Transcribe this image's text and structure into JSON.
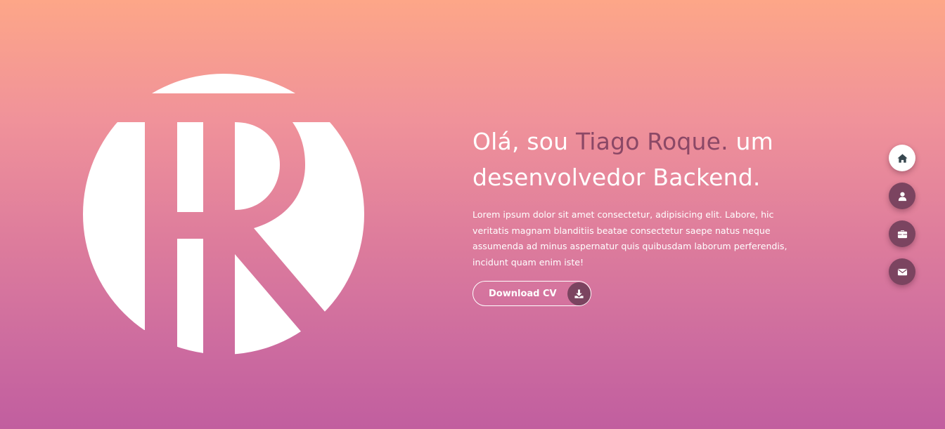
{
  "hero": {
    "greeting": "Olá, sou ",
    "name": "Tiago Roque.",
    "role": " um desenvolvedor Backend.",
    "description": "Lorem ipsum dolor sit amet consectetur, adipisicing elit. Labore, hic veritatis magnam blanditiis beatae consectetur saepe natus neque assumenda ad minus aspernatur quis quibusdam laborum perferendis, incidunt quam enim iste!",
    "cv_button": {
      "label": "Download CV",
      "icon": "download-icon"
    }
  },
  "logo": {
    "icon": "tr-monogram-logo"
  },
  "side_nav": {
    "items": [
      {
        "icon": "home-icon",
        "active": true
      },
      {
        "icon": "user-icon",
        "active": false
      },
      {
        "icon": "briefcase-icon",
        "active": false
      },
      {
        "icon": "envelope-icon",
        "active": false
      }
    ]
  },
  "colors": {
    "gradient_top": "#fda688",
    "gradient_bottom": "#c15e9f",
    "accent": "#8b4866",
    "button_dark": "#7b4460",
    "white": "#ffffff"
  }
}
